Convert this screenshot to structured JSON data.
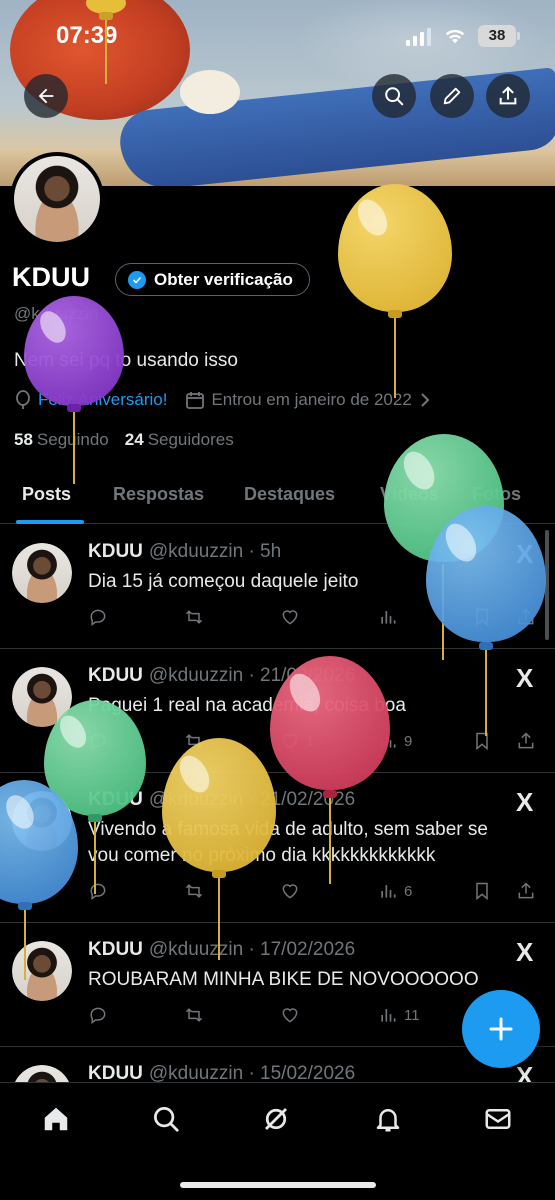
{
  "status_bar": {
    "time": "07:39",
    "battery": "38"
  },
  "profile": {
    "name": "KDUU",
    "verify_label": "Obter verificação",
    "handle": "@kduuzzin",
    "bio": "Nem sei pq to usando isso",
    "birthday": "Feliz Aniversário!",
    "joined": "Entrou em janeiro de 2022",
    "following_count": "58",
    "following_label": "Seguindo",
    "followers_count": "24",
    "followers_label": "Seguidores"
  },
  "tabs": [
    "Posts",
    "Respostas",
    "Destaques",
    "Vídeos",
    "Fotos"
  ],
  "posts": [
    {
      "name": "KDUU",
      "meta": "@kduuzzin · 5h",
      "text": "Dia 15 já começou daquele jeito",
      "views": ""
    },
    {
      "name": "KDUU",
      "meta": "@kduuzzin · 21/02/2026",
      "text": "Paguei 1 real na academia, coisa boa",
      "likes": "1",
      "views": "9"
    },
    {
      "name": "KDUU",
      "meta": "@kduuzzin · 21/02/2026",
      "text": "Vivendo a famosa vida de adulto, sem saber se vou comer no próximo dia kkkkkkkkkkkkk",
      "views": "6"
    },
    {
      "name": "KDUU",
      "meta": "@kduuzzin · 17/02/2026",
      "text": "ROUBARAM MINHA BIKE DE NOVOOOOOO",
      "views": "11"
    },
    {
      "name": "KDUU",
      "meta": "@kduuzzin · 15/02/2026",
      "text": ""
    }
  ],
  "x_logo": "X",
  "icons": {
    "back": "arrow-left-icon",
    "search": "search-icon",
    "edit": "pencil-icon",
    "share": "share-icon",
    "fab": "plus-icon",
    "nav": [
      "home-icon",
      "search-icon",
      "grok-icon",
      "bell-icon",
      "mail-icon"
    ]
  },
  "colors": {
    "accent": "#1d9bf0",
    "background": "#000000",
    "muted": "#71767b"
  }
}
